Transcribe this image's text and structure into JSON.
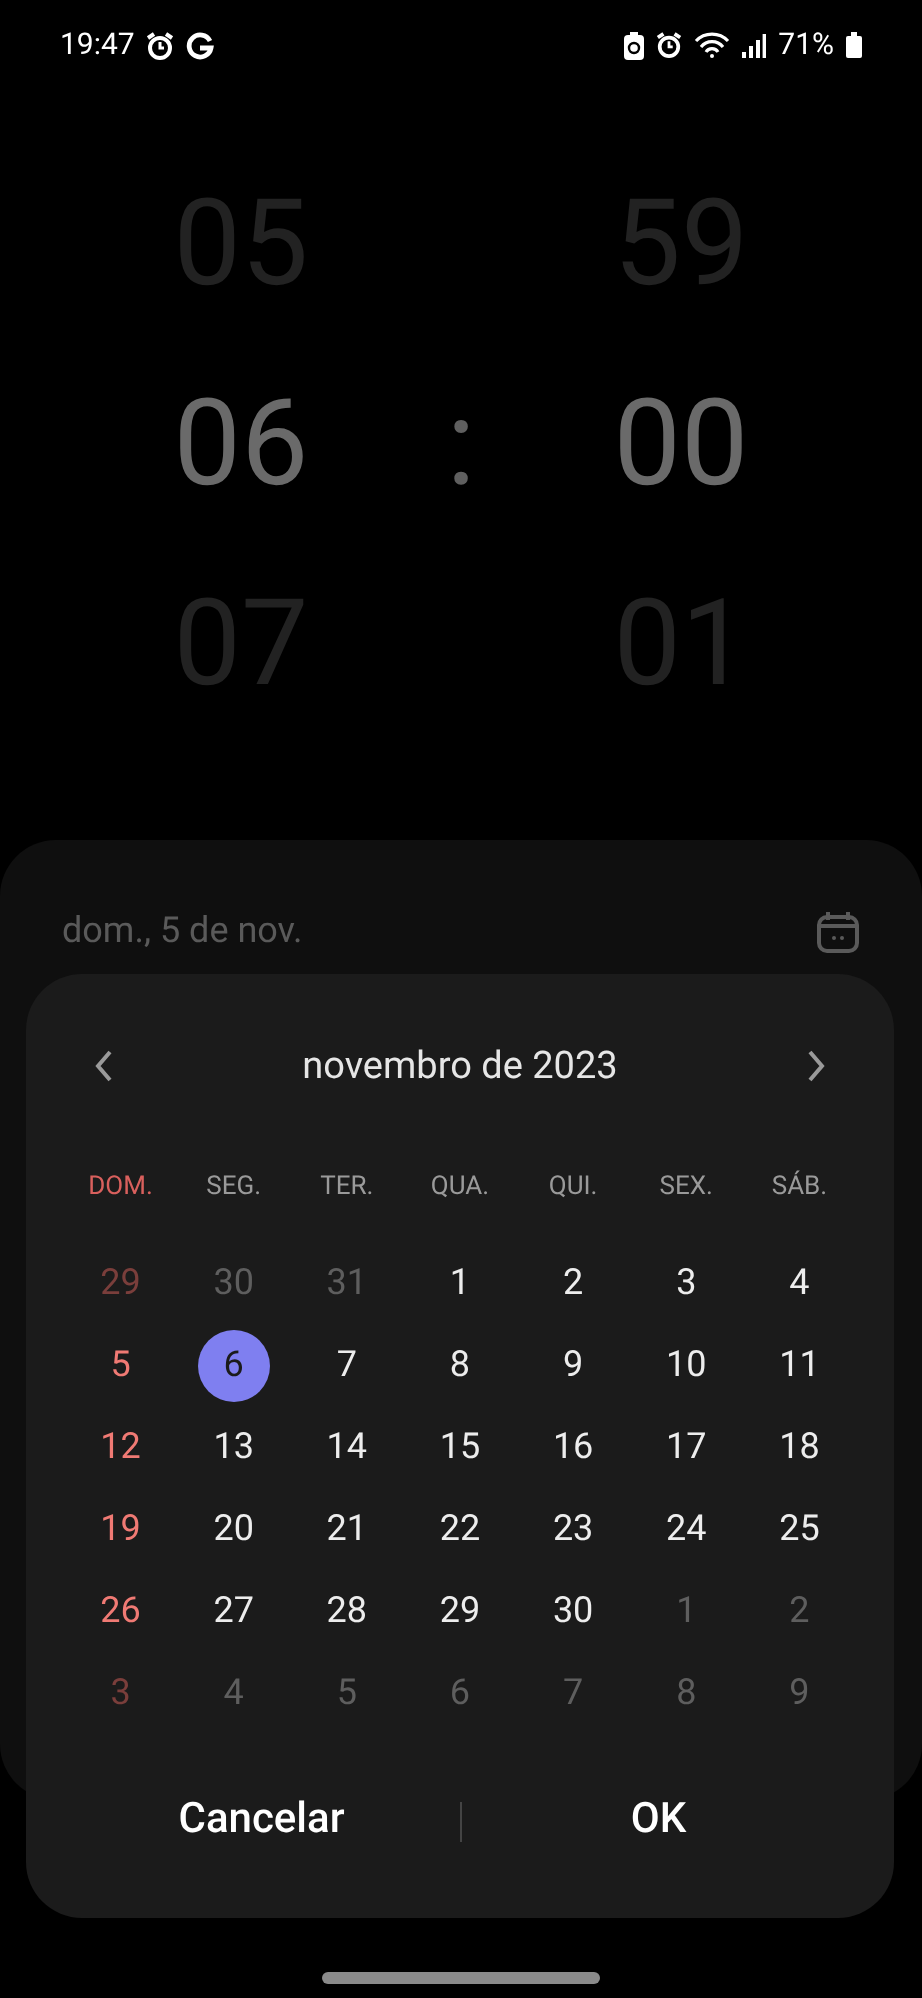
{
  "status_bar": {
    "time": "19:47",
    "battery": "71%"
  },
  "time_picker": {
    "hours": [
      {
        "value": "05",
        "selected": false
      },
      {
        "value": "06",
        "selected": true
      },
      {
        "value": "07",
        "selected": false
      }
    ],
    "separator": ":",
    "minutes": [
      {
        "value": "59",
        "selected": false
      },
      {
        "value": "00",
        "selected": true
      },
      {
        "value": "01",
        "selected": false
      }
    ]
  },
  "date_sheet": {
    "date": "dom., 5 de nov."
  },
  "calendar": {
    "month": "novembro de 2023",
    "weekdays": [
      "DOM.",
      "SEG.",
      "TER.",
      "QUA.",
      "QUI.",
      "SEX.",
      "SÁB."
    ],
    "weeks": [
      [
        {
          "day": "29",
          "in_month": false,
          "selected": false
        },
        {
          "day": "30",
          "in_month": false,
          "selected": false
        },
        {
          "day": "31",
          "in_month": false,
          "selected": false
        },
        {
          "day": "1",
          "in_month": true,
          "selected": false
        },
        {
          "day": "2",
          "in_month": true,
          "selected": false
        },
        {
          "day": "3",
          "in_month": true,
          "selected": false
        },
        {
          "day": "4",
          "in_month": true,
          "selected": false
        }
      ],
      [
        {
          "day": "5",
          "in_month": true,
          "selected": false
        },
        {
          "day": "6",
          "in_month": true,
          "selected": true
        },
        {
          "day": "7",
          "in_month": true,
          "selected": false
        },
        {
          "day": "8",
          "in_month": true,
          "selected": false
        },
        {
          "day": "9",
          "in_month": true,
          "selected": false
        },
        {
          "day": "10",
          "in_month": true,
          "selected": false
        },
        {
          "day": "11",
          "in_month": true,
          "selected": false
        }
      ],
      [
        {
          "day": "12",
          "in_month": true,
          "selected": false
        },
        {
          "day": "13",
          "in_month": true,
          "selected": false
        },
        {
          "day": "14",
          "in_month": true,
          "selected": false
        },
        {
          "day": "15",
          "in_month": true,
          "selected": false
        },
        {
          "day": "16",
          "in_month": true,
          "selected": false
        },
        {
          "day": "17",
          "in_month": true,
          "selected": false
        },
        {
          "day": "18",
          "in_month": true,
          "selected": false
        }
      ],
      [
        {
          "day": "19",
          "in_month": true,
          "selected": false
        },
        {
          "day": "20",
          "in_month": true,
          "selected": false
        },
        {
          "day": "21",
          "in_month": true,
          "selected": false
        },
        {
          "day": "22",
          "in_month": true,
          "selected": false
        },
        {
          "day": "23",
          "in_month": true,
          "selected": false
        },
        {
          "day": "24",
          "in_month": true,
          "selected": false
        },
        {
          "day": "25",
          "in_month": true,
          "selected": false
        }
      ],
      [
        {
          "day": "26",
          "in_month": true,
          "selected": false
        },
        {
          "day": "27",
          "in_month": true,
          "selected": false
        },
        {
          "day": "28",
          "in_month": true,
          "selected": false
        },
        {
          "day": "29",
          "in_month": true,
          "selected": false
        },
        {
          "day": "30",
          "in_month": true,
          "selected": false
        },
        {
          "day": "1",
          "in_month": false,
          "selected": false
        },
        {
          "day": "2",
          "in_month": false,
          "selected": false
        }
      ],
      [
        {
          "day": "3",
          "in_month": false,
          "selected": false
        },
        {
          "day": "4",
          "in_month": false,
          "selected": false
        },
        {
          "day": "5",
          "in_month": false,
          "selected": false
        },
        {
          "day": "6",
          "in_month": false,
          "selected": false
        },
        {
          "day": "7",
          "in_month": false,
          "selected": false
        },
        {
          "day": "8",
          "in_month": false,
          "selected": false
        },
        {
          "day": "9",
          "in_month": false,
          "selected": false
        }
      ]
    ],
    "buttons": [
      "Cancelar",
      "OK"
    ]
  }
}
